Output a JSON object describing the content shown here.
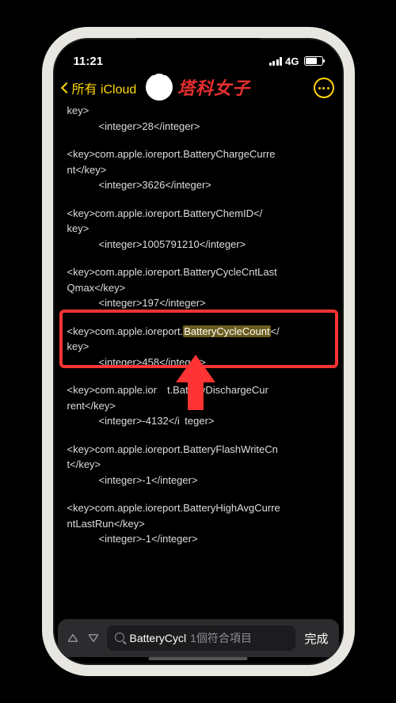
{
  "status": {
    "time": "11:21",
    "network": "4G"
  },
  "nav": {
    "back_label": "所有 iCloud"
  },
  "logo": {
    "text": "塔科女子"
  },
  "lines": {
    "l0": "key>",
    "l1": "<integer>28</integer>",
    "l2a": "<key>com.apple.ioreport.BatteryChargeCurre",
    "l2b": "nt</key>",
    "l3": "<integer>3626</integer>",
    "l4a": "<key>com.apple.ioreport.BatteryChemID</",
    "l4b": "key>",
    "l5": "<integer>1005791210</integer>",
    "l6a": "<key>com.apple.ioreport.BatteryCycleCntLast",
    "l6b": "Qmax</key>",
    "l7": "<integer>197</integer>",
    "l8a_pre": "<key>com.apple.ioreport.",
    "l8a_hl": "BatteryCycleCount",
    "l8a_post": "</",
    "l8b": "key>",
    "l9": "<integer>458</integer>",
    "l10a": "<key>com.apple.ior",
    "l10a2": "t.BatteryDischargeCur",
    "l10b": "rent</key>",
    "l11a": "<integer>-4132</i",
    "l11b": "teger>",
    "l12a": "<key>com.apple.ioreport.BatteryFlashWriteCn",
    "l12b": "t</key>",
    "l13": "<integer>-1</integer>",
    "l14a": "<key>com.apple.ioreport.BatteryHighAvgCurre",
    "l14b": "ntLastRun</key>",
    "l15": "<integer>-1</integer>"
  },
  "search": {
    "input_text": "BatteryCycl",
    "result_count": "1個符合項目",
    "done_label": "完成"
  }
}
